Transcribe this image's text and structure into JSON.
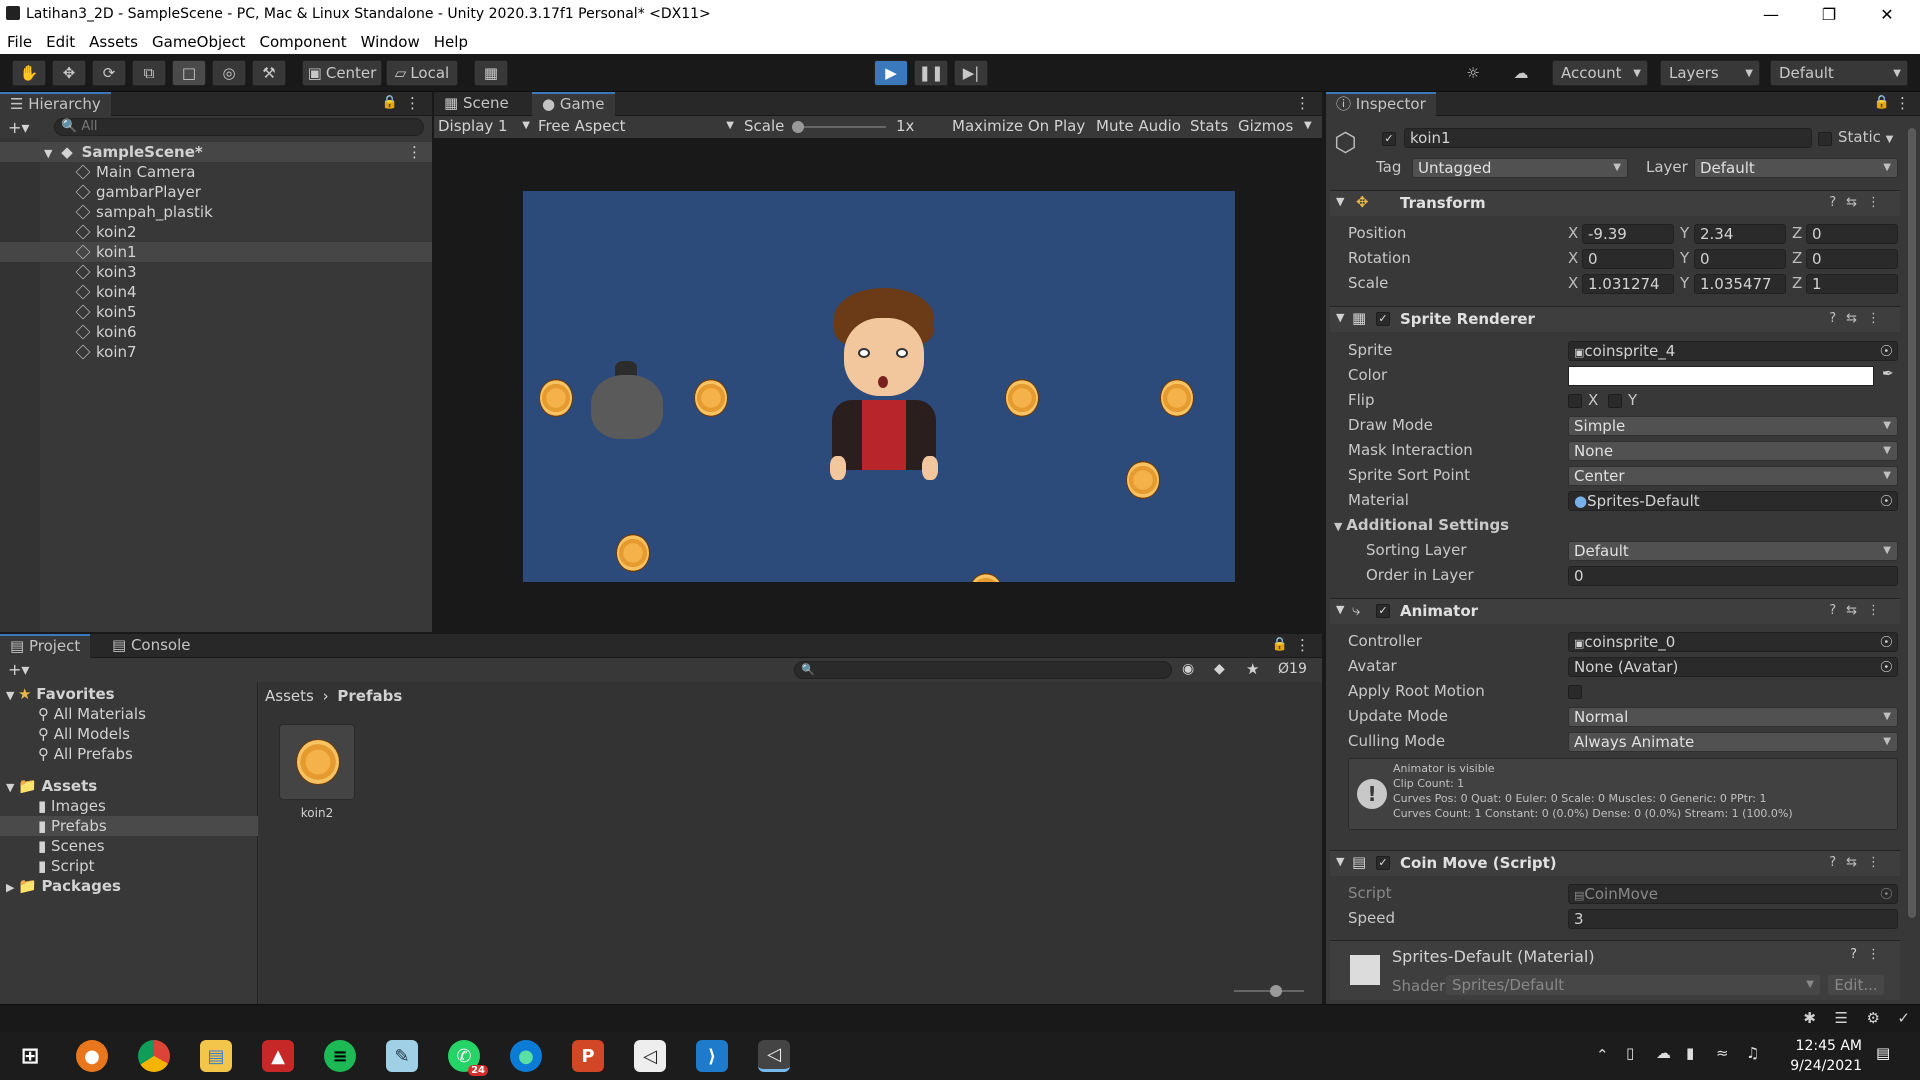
{
  "window": {
    "title": "Latihan3_2D - SampleScene - PC, Mac & Linux Standalone - Unity 2020.3.17f1 Personal* <DX11>"
  },
  "menu": [
    "File",
    "Edit",
    "Assets",
    "GameObject",
    "Component",
    "Window",
    "Help"
  ],
  "toolbar": {
    "pivot": "Center",
    "space": "Local",
    "account": "Account",
    "layers": "Layers",
    "layout": "Default"
  },
  "hierarchy": {
    "tab": "Hierarchy",
    "search_placeholder": "All",
    "scene": "SampleScene*",
    "items": [
      "Main Camera",
      "gambarPlayer",
      "sampah_plastik",
      "koin2",
      "koin1",
      "koin3",
      "koin4",
      "koin5",
      "koin6",
      "koin7"
    ],
    "selected": "koin1"
  },
  "game": {
    "tabs": [
      "Scene",
      "Game"
    ],
    "display": "Display 1",
    "aspect": "Free Aspect",
    "scale_label": "Scale",
    "scale_value": "1x",
    "buttons": [
      "Maximize On Play",
      "Mute Audio",
      "Stats",
      "Gizmos"
    ],
    "background": "#2c4a7a"
  },
  "project": {
    "tabs": [
      "Project",
      "Console"
    ],
    "hidden_count": "19",
    "favorites_label": "Favorites",
    "favorites": [
      "All Materials",
      "All Models",
      "All Prefabs"
    ],
    "assets_label": "Assets",
    "asset_folders": [
      "Images",
      "Prefabs",
      "Scenes",
      "Script"
    ],
    "packages_label": "Packages",
    "breadcrumb": [
      "Assets",
      "Prefabs"
    ],
    "asset_item": "koin2"
  },
  "inspector": {
    "tab": "Inspector",
    "object_name": "koin1",
    "static_label": "Static",
    "tag_label": "Tag",
    "tag": "Untagged",
    "layer_label": "Layer",
    "layer": "Default",
    "transform": {
      "title": "Transform",
      "position_label": "Position",
      "position": [
        "-9.39",
        "2.34",
        "0"
      ],
      "rotation_label": "Rotation",
      "rotation": [
        "0",
        "0",
        "0"
      ],
      "scale_label": "Scale",
      "scale": [
        "1.031274",
        "1.035477",
        "1"
      ]
    },
    "sprite_renderer": {
      "title": "Sprite Renderer",
      "sprite_label": "Sprite",
      "sprite": "coinsprite_4",
      "color_label": "Color",
      "flip_label": "Flip",
      "flip_x": "X",
      "flip_y": "Y",
      "draw_mode_label": "Draw Mode",
      "draw_mode": "Simple",
      "mask_label": "Mask Interaction",
      "mask": "None",
      "sort_point_label": "Sprite Sort Point",
      "sort_point": "Center",
      "material_label": "Material",
      "material": "Sprites-Default",
      "additional_label": "Additional Settings",
      "sorting_layer_label": "Sorting Layer",
      "sorting_layer": "Default",
      "order_label": "Order in Layer",
      "order": "0"
    },
    "animator": {
      "title": "Animator",
      "controller_label": "Controller",
      "controller": "coinsprite_0",
      "avatar_label": "Avatar",
      "avatar": "None (Avatar)",
      "root_motion_label": "Apply Root Motion",
      "update_mode_label": "Update Mode",
      "update_mode": "Normal",
      "culling_label": "Culling Mode",
      "culling": "Always Animate",
      "info": [
        "Animator is visible",
        "Clip Count: 1",
        "Curves Pos: 0 Quat: 0 Euler: 0 Scale: 0 Muscles: 0 Generic: 0 PPtr: 1",
        "Curves Count: 1 Constant: 0 (0.0%) Dense: 0 (0.0%) Stream: 1 (100.0%)"
      ]
    },
    "coin_move": {
      "title": "Coin Move (Script)",
      "script_label": "Script",
      "script": "CoinMove",
      "speed_label": "Speed",
      "speed": "3"
    },
    "material": {
      "title": "Sprites-Default (Material)",
      "shader_label": "Shader",
      "shader": "Sprites/Default",
      "edit": "Edit..."
    }
  },
  "taskbar": {
    "time": "12:45 AM",
    "date": "9/24/2021",
    "badge": "24"
  }
}
